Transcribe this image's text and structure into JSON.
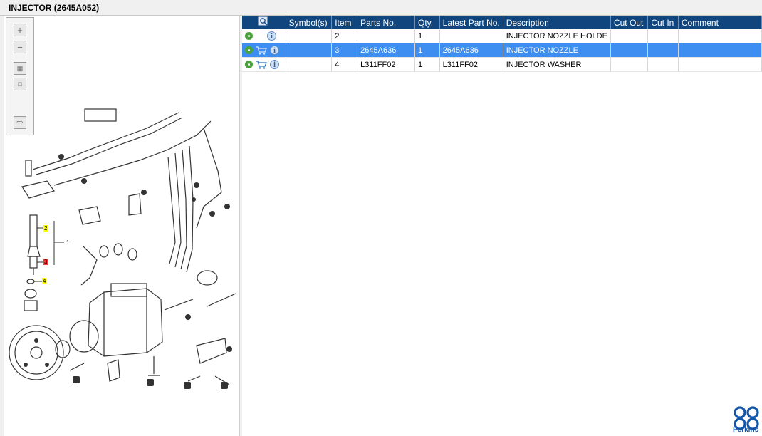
{
  "window": {
    "title": "INJECTOR (2645A052)"
  },
  "toolbox": {
    "icons": [
      "zoom-in-icon",
      "zoom-out-icon",
      "fit-all-icon",
      "actual-size-icon",
      "export-icon"
    ]
  },
  "diagram": {
    "callouts": [
      {
        "label": "2",
        "color": "#ffff00"
      },
      {
        "label": "3",
        "color": "#ff3b3b"
      },
      {
        "label": "4",
        "color": "#ffff00"
      },
      {
        "label": "1",
        "color": ""
      }
    ]
  },
  "table": {
    "columns": [
      "",
      "Symbol(s)",
      "Item",
      "Parts No.",
      "Qty.",
      "Latest Part No.",
      "Description",
      "Cut Out",
      "Cut In",
      "Comment"
    ],
    "rows": [
      {
        "item": "2",
        "part_no": "",
        "qty": "1",
        "latest": "",
        "description": "INJECTOR NOZZLE HOLDE",
        "cut_out": "",
        "cut_in": "",
        "comment": "",
        "has_cart": false,
        "selected": false
      },
      {
        "item": "3",
        "part_no": "2645A636",
        "qty": "1",
        "latest": "2645A636",
        "description": "INJECTOR NOZZLE",
        "cut_out": "",
        "cut_in": "",
        "comment": "",
        "has_cart": true,
        "selected": true
      },
      {
        "item": "4",
        "part_no": "L311FF02",
        "qty": "1",
        "latest": "L311FF02",
        "description": "INJECTOR WASHER",
        "cut_out": "",
        "cut_in": "",
        "comment": "",
        "has_cart": true,
        "selected": false
      }
    ]
  },
  "brand": {
    "name": "Perkins",
    "color": "#1457a8"
  },
  "colors": {
    "header": "#10457d",
    "selected_row": "#3d8ef0"
  }
}
